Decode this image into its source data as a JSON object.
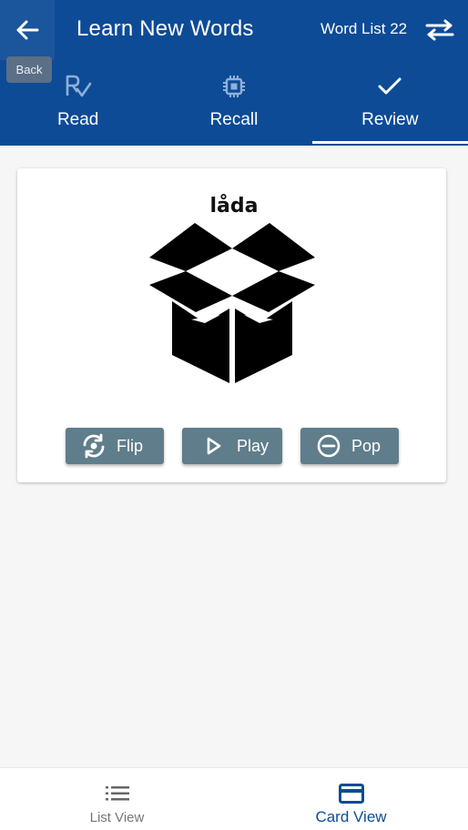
{
  "header": {
    "title": "Learn New Words",
    "word_list": "Word List 22",
    "back_tooltip": "Back",
    "back_icon": "arrow-left-icon",
    "swap_icon": "swap-arrows-icon"
  },
  "tabs": [
    {
      "label": "Read",
      "icon": "rx-check-icon",
      "active": false
    },
    {
      "label": "Recall",
      "icon": "chip-icon",
      "active": false
    },
    {
      "label": "Review",
      "icon": "check-icon",
      "active": true
    }
  ],
  "card": {
    "word": "låda",
    "image_icon": "open-box-icon",
    "buttons": [
      {
        "label": "Flip",
        "icon": "flip-camera-icon"
      },
      {
        "label": "Play",
        "icon": "play-icon"
      },
      {
        "label": "Pop",
        "icon": "minus-circle-icon"
      }
    ]
  },
  "bottom_nav": [
    {
      "label": "List View",
      "icon": "list-icon",
      "active": false
    },
    {
      "label": "Card View",
      "icon": "card-icon",
      "active": true
    }
  ],
  "colors": {
    "primary": "#0d4b96",
    "button": "#607d8b",
    "background": "#f6f6f6"
  }
}
